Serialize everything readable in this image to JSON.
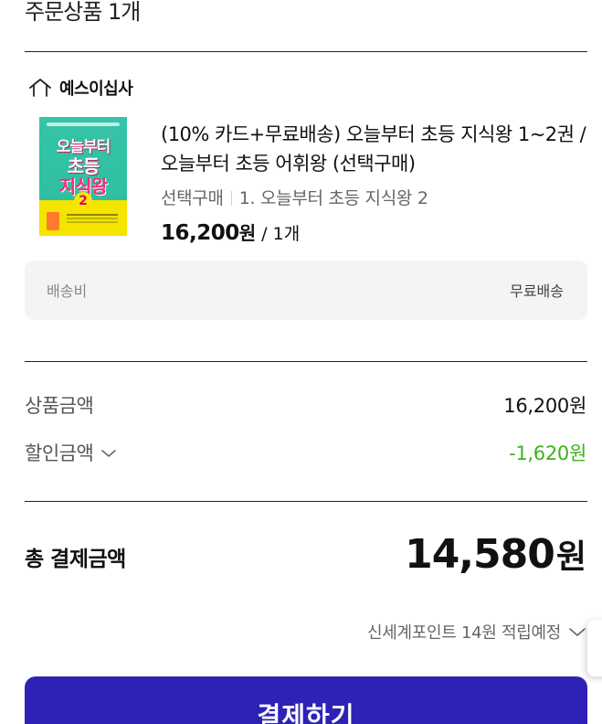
{
  "order": {
    "section_title": "주문상품 1개",
    "store": {
      "icon": "home-icon",
      "name": "예스이십사"
    },
    "item": {
      "thumbnail": {
        "line1": "오늘부터",
        "line2": "초등",
        "line3": "지식왕",
        "number": "2"
      },
      "title": "(10% 카드+무료배송) 오늘부터 초등 지식왕 1~2권 / 오늘부터 초등 어휘왕 (선택구매)",
      "option_label": "선택구매",
      "option_value": "1. 오늘부터 초등 지식왕 2",
      "price": "16,200",
      "currency": "원",
      "quantity": "/ 1개"
    },
    "shipping": {
      "label": "배송비",
      "value": "무료배송"
    }
  },
  "summary": {
    "product_amount_label": "상품금액",
    "product_amount_value": "16,200원",
    "discount_label": "할인금액",
    "discount_value": "-1,620원",
    "total_label": "총 결제금액",
    "total_amount": "14,580",
    "total_currency": "원",
    "points_text": "신세계포인트 14원 적립예정"
  },
  "actions": {
    "pay_label": "결제하기"
  },
  "colors": {
    "primary": "#2e22b6",
    "discount": "#3bb41b",
    "shipping_bg": "#f4f4f4"
  }
}
